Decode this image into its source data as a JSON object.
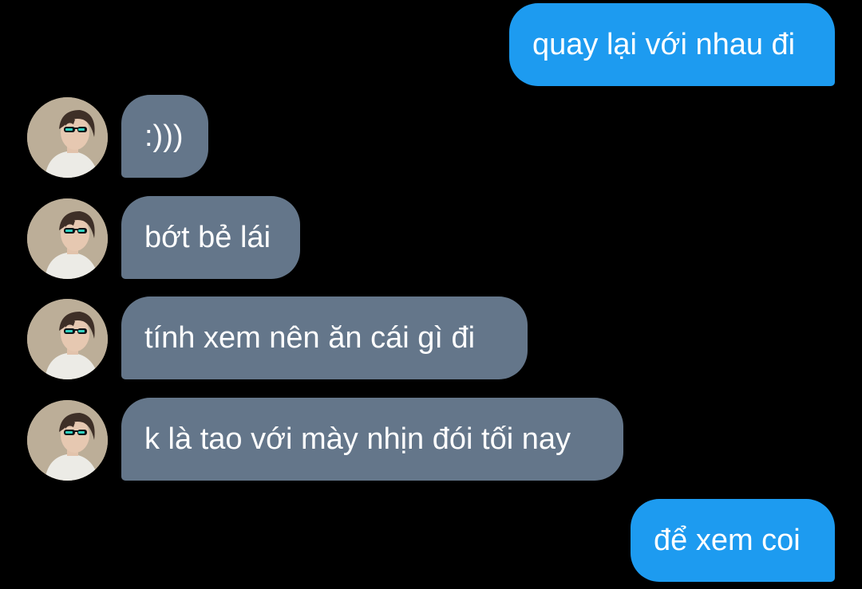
{
  "conversation": {
    "messages": [
      {
        "sender": "me",
        "text": "quay lại với nhau đi"
      },
      {
        "sender": "them",
        "text": ":)))"
      },
      {
        "sender": "them",
        "text": "bớt bẻ lái"
      },
      {
        "sender": "them",
        "text": "tính xem nên ăn cái gì đi"
      },
      {
        "sender": "them",
        "text": "k là tao với mày nhịn đói tối nay"
      },
      {
        "sender": "me",
        "text": "để xem coi"
      }
    ]
  },
  "colors": {
    "background": "#000000",
    "outgoing_bubble": "#1d9bf0",
    "incoming_bubble": "#64768a",
    "text": "#ffffff"
  },
  "icons": {
    "contact_avatar": "profile-photo-person-with-sunglasses"
  }
}
